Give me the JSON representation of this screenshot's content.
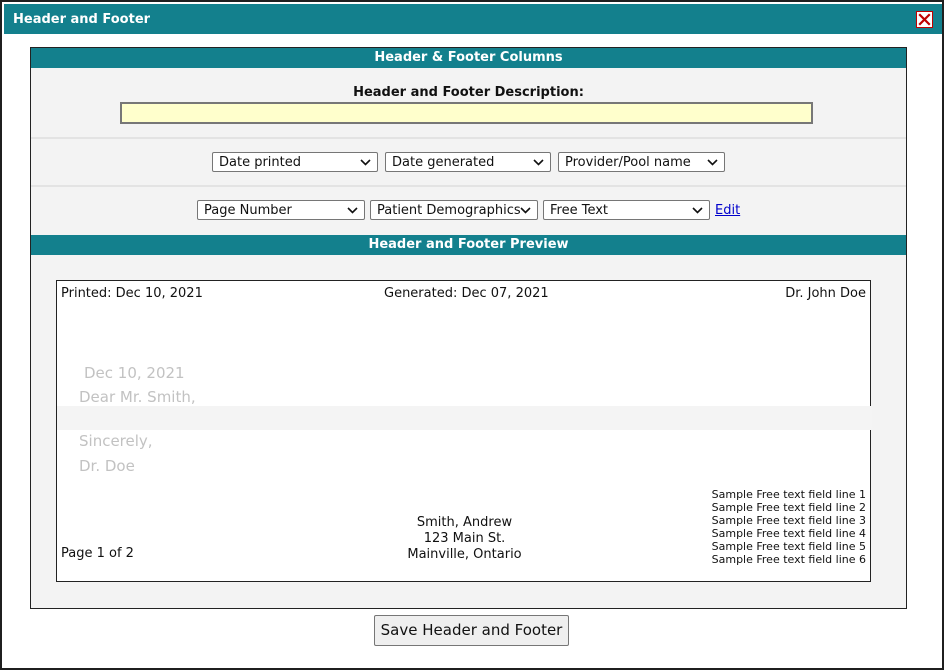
{
  "window": {
    "title": "Header and Footer",
    "close_icon": "close-icon"
  },
  "columns_section": {
    "title": "Header & Footer Columns"
  },
  "description": {
    "label": "Header and Footer Description:",
    "value": ""
  },
  "header_selects": [
    {
      "value": "Date printed"
    },
    {
      "value": "Date generated"
    },
    {
      "value": "Provider/Pool name"
    }
  ],
  "footer_selects": [
    {
      "value": "Page Number"
    },
    {
      "value": "Patient Demographics"
    },
    {
      "value": "Free Text"
    }
  ],
  "edit_link": "Edit",
  "preview_section": {
    "title": "Header and Footer Preview"
  },
  "preview": {
    "header_left": "Printed: Dec 10, 2021",
    "header_center": "Generated: Dec 07, 2021",
    "header_right": "Dr. John Doe",
    "body": {
      "date": "Dec 10, 2021",
      "greeting": "Dear Mr. Smith,",
      "closing": "Sincerely,",
      "signature": "Dr. Doe"
    },
    "footer_left": "Page 1 of 2",
    "footer_center": [
      "Smith, Andrew",
      "123 Main St.",
      "Mainville, Ontario"
    ],
    "footer_right": [
      "Sample Free text field line 1",
      "Sample Free text field line 2",
      "Sample Free text field line 3",
      "Sample Free text field line 4",
      "Sample Free text field line 5",
      "Sample Free text field line 6"
    ]
  },
  "save_button": "Save Header and Footer",
  "colors": {
    "accent": "#13808d",
    "input_bg": "#ffffcc",
    "close_red": "#c00000",
    "link": "#0000cc"
  }
}
